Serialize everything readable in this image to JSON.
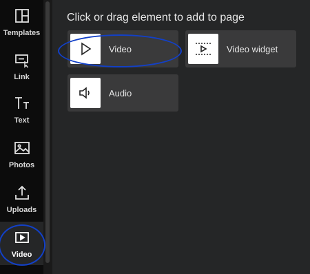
{
  "sidebar": {
    "items": [
      {
        "label": "Templates",
        "icon": "templates-icon"
      },
      {
        "label": "Link",
        "icon": "link-icon"
      },
      {
        "label": "Text",
        "icon": "text-icon"
      },
      {
        "label": "Photos",
        "icon": "photos-icon"
      },
      {
        "label": "Uploads",
        "icon": "uploads-icon"
      },
      {
        "label": "Video",
        "icon": "video-icon",
        "active": true
      }
    ]
  },
  "main": {
    "heading": "Click or drag element to add to page",
    "tiles": [
      {
        "label": "Video",
        "icon": "play-icon"
      },
      {
        "label": "Video widget",
        "icon": "video-widget-icon"
      },
      {
        "label": "Audio",
        "icon": "speaker-icon"
      }
    ]
  },
  "colors": {
    "sidebar_bg": "#0c0c0c",
    "panel_bg": "#252627",
    "tile_bg": "#3a3a3b",
    "highlight": "#1240c8"
  }
}
